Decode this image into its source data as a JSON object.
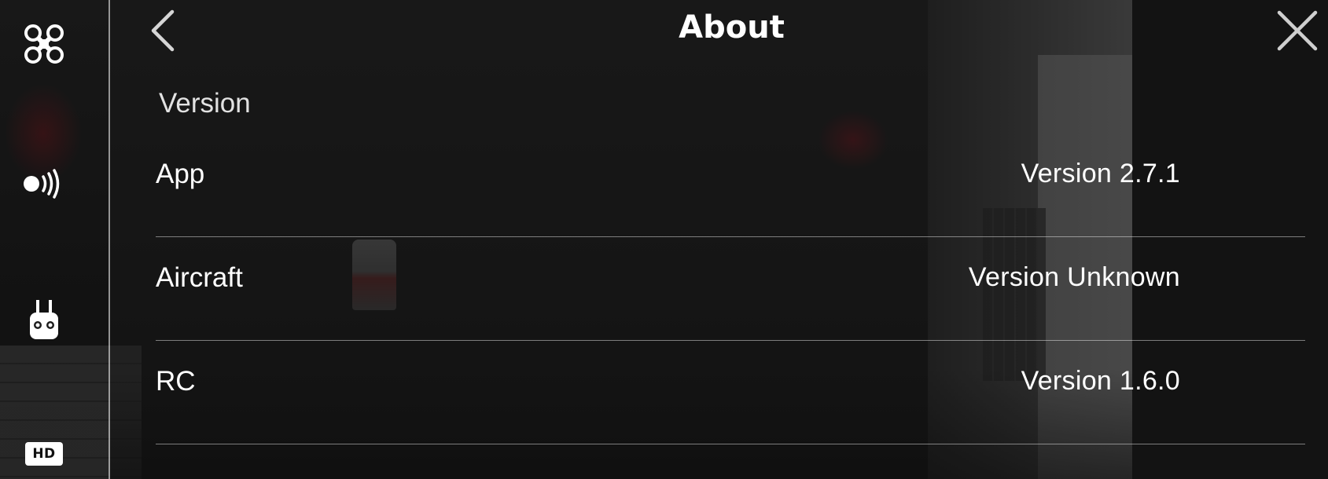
{
  "header": {
    "title": "About",
    "back_icon": "chevron-left-icon",
    "close_icon": "close-icon"
  },
  "sidebar": {
    "items": [
      {
        "name": "aircraft",
        "icon": "drone-icon"
      },
      {
        "name": "transmission",
        "icon": "signal-icon"
      },
      {
        "name": "remote-controller",
        "icon": "remote-controller-icon"
      },
      {
        "name": "hd",
        "icon": "hd-icon",
        "label": "HD"
      }
    ]
  },
  "section": {
    "label": "Version"
  },
  "rows": [
    {
      "label": "App",
      "value": "Version 2.7.1"
    },
    {
      "label": "Aircraft",
      "value": "Version Unknown"
    },
    {
      "label": "RC",
      "value": "Version 1.6.0"
    }
  ],
  "colors": {
    "text": "#ffffff",
    "divider": "#9a9a9a",
    "overlay": "#121212"
  }
}
